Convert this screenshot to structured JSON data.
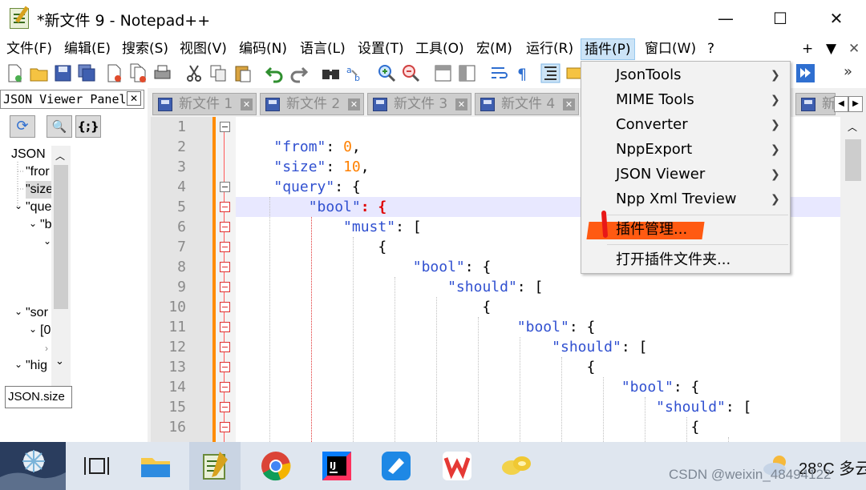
{
  "window": {
    "title": "*新文件 9 - Notepad++"
  },
  "window_controls": {
    "minimize": "—",
    "maximize": "☐",
    "close": "✕"
  },
  "menubar": {
    "items": [
      "文件(F)",
      "编辑(E)",
      "搜索(S)",
      "视图(V)",
      "编码(N)",
      "语言(L)",
      "设置(T)",
      "工具(O)",
      "宏(M)",
      "运行(R)",
      "插件(P)",
      "窗口(W)",
      "?"
    ],
    "right_controls": [
      "+",
      "▼",
      "✕"
    ],
    "active_item": "插件(P)"
  },
  "toolbar": {
    "icons": [
      "new-file-icon",
      "open-file-icon",
      "save-icon",
      "save-all-icon",
      "close-icon",
      "close-all-icon",
      "print-icon",
      "cut-icon",
      "copy-icon",
      "paste-icon",
      "undo-icon",
      "redo-icon",
      "find-icon",
      "replace-icon",
      "zoom-in-icon",
      "zoom-out-icon",
      "sync-v-icon",
      "sync-h-icon",
      "word-wrap-icon",
      "show-all-chars-icon",
      "indent-guide-icon",
      "user-lang-icon",
      "macro-play-icon",
      "more-icon"
    ]
  },
  "json_panel": {
    "title": "JSON Viewer Panel",
    "close": "✕",
    "buttons": {
      "refresh": "⟳",
      "search": "🔍",
      "format": "{;}"
    },
    "tree": [
      {
        "text": "JSON",
        "exp": ""
      },
      {
        "text": "\"fror",
        "exp": ""
      },
      {
        "text": "\"size",
        "exp": "",
        "selected": true
      },
      {
        "text": "\"que",
        "exp": "⌄"
      },
      {
        "text": "\"b",
        "exp": "⌄"
      },
      {
        "text": "",
        "exp": "⌄"
      },
      {
        "text": "\"sor",
        "exp": "⌄"
      },
      {
        "text": "[0",
        "exp": "⌄"
      },
      {
        "text": "",
        "exp": "›"
      },
      {
        "text": "\"hig",
        "exp": "⌄"
      }
    ],
    "path": "JSON.size"
  },
  "doc_tabs": [
    {
      "label": "新文件 1"
    },
    {
      "label": "新文件 2"
    },
    {
      "label": "新文件 3"
    },
    {
      "label": "新文件 4"
    },
    {
      "label": "新"
    }
  ],
  "tab_nav": {
    "prev": "◀",
    "next": "▶"
  },
  "editor": {
    "current_line": 5,
    "lines": [
      {
        "n": "1",
        "code": ""
      },
      {
        "n": "2",
        "code": "    \"from\": 0,"
      },
      {
        "n": "3",
        "code": "    \"size\": 10,"
      },
      {
        "n": "4",
        "code": "    \"query\": {"
      },
      {
        "n": "5",
        "code": "        \"bool\": {"
      },
      {
        "n": "6",
        "code": "            \"must\": ["
      },
      {
        "n": "7",
        "code": "                {"
      },
      {
        "n": "8",
        "code": "                    \"bool\": {"
      },
      {
        "n": "9",
        "code": "                        \"should\": ["
      },
      {
        "n": "10",
        "code": "                            {"
      },
      {
        "n": "11",
        "code": "                                \"bool\": {"
      },
      {
        "n": "12",
        "code": "                                    \"should\": ["
      },
      {
        "n": "13",
        "code": "                                        {"
      },
      {
        "n": "14",
        "code": "                                            \"bool\": {"
      },
      {
        "n": "15",
        "code": "                                                \"should\": ["
      },
      {
        "n": "16",
        "code": "                                                    {"
      }
    ]
  },
  "plugin_menu": {
    "items": [
      {
        "label": "JsonTools",
        "submenu": true
      },
      {
        "label": "MIME Tools",
        "submenu": true
      },
      {
        "label": "Converter",
        "submenu": true
      },
      {
        "label": "NppExport",
        "submenu": true
      },
      {
        "label": "JSON Viewer",
        "submenu": true
      },
      {
        "label": "Npp Xml Treview",
        "submenu": true
      },
      {
        "label": "插件管理...",
        "submenu": false,
        "highlighted": true
      },
      {
        "label": "打开插件文件夹...",
        "submenu": false
      }
    ]
  },
  "taskbar": {
    "apps": [
      "desktop-thumbnail-icon",
      "task-view-icon",
      "file-explorer-icon",
      "notepadpp-icon",
      "chrome-icon",
      "intellij-icon",
      "feishu-icon",
      "wps-icon",
      "pinned-app-icon"
    ],
    "weather": {
      "temperature": "28°C",
      "text": "多云"
    },
    "watermark": "CSDN @weixin_48494122"
  },
  "colors": {
    "string": "#3050d0",
    "number": "#ff8000",
    "highlight_mark": "#ff5a12",
    "menu_active": "#cce4f7"
  }
}
